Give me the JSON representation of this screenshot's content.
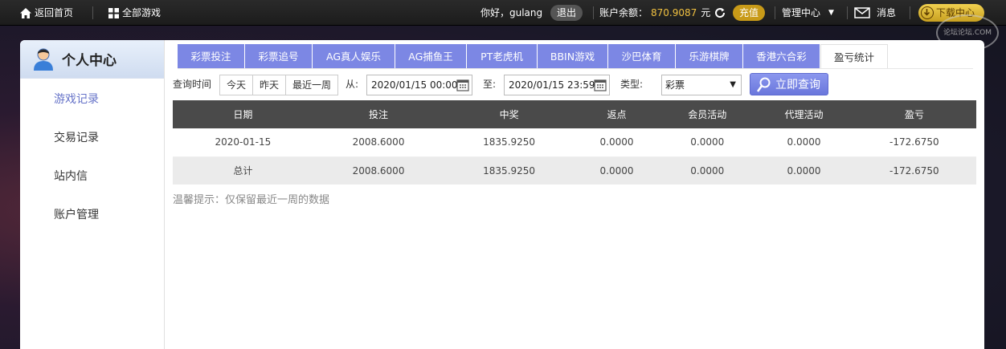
{
  "topbar": {
    "home_label": "返回首页",
    "all_games_label": "全部游戏",
    "greeting": "你好，gulang",
    "logout_label": "退出",
    "balance_label": "账户余额：",
    "balance_value": "870.9087",
    "balance_unit": "元",
    "recharge_label": "充值",
    "manage_label": "管理中心",
    "message_label": "消息",
    "download_label": "下载中心",
    "watermark_text": "论坛论坛.COM"
  },
  "sidebar": {
    "title": "个人中心",
    "items": [
      {
        "label": "游戏记录"
      },
      {
        "label": "交易记录"
      },
      {
        "label": "站内信"
      },
      {
        "label": "账户管理"
      }
    ]
  },
  "tabs": [
    {
      "label": "彩票投注"
    },
    {
      "label": "彩票追号"
    },
    {
      "label": "AG真人娱乐"
    },
    {
      "label": "AG捕鱼王"
    },
    {
      "label": "PT老虎机"
    },
    {
      "label": "BBIN游戏"
    },
    {
      "label": "沙巴体育"
    },
    {
      "label": "乐游棋牌"
    },
    {
      "label": "香港六合彩"
    },
    {
      "label": "盈亏统计"
    }
  ],
  "query": {
    "time_label": "查询时间",
    "today_label": "今天",
    "yesterday_label": "昨天",
    "week_label": "最近一周",
    "from_label": "从:",
    "from_value": "2020/01/15 00:00",
    "to_label": "至:",
    "to_value": "2020/01/15 23:59",
    "type_label": "类型:",
    "type_value": "彩票",
    "search_label": "立即查询"
  },
  "table": {
    "headers": [
      "日期",
      "投注",
      "中奖",
      "返点",
      "会员活动",
      "代理活动",
      "盈亏"
    ],
    "rows": [
      [
        "2020-01-15",
        "2008.6000",
        "1835.9250",
        "0.0000",
        "0.0000",
        "0.0000",
        "-172.6750"
      ],
      [
        "总计",
        "2008.6000",
        "1835.9250",
        "0.0000",
        "0.0000",
        "0.0000",
        "-172.6750"
      ]
    ]
  },
  "hint": "温馨提示：仅保留最近一周的数据",
  "colors": {
    "tab_blue": "#7c87e4",
    "header_dark": "#4a4a4a",
    "accent_gold": "#c89a18",
    "active_side": "#6673c8"
  }
}
